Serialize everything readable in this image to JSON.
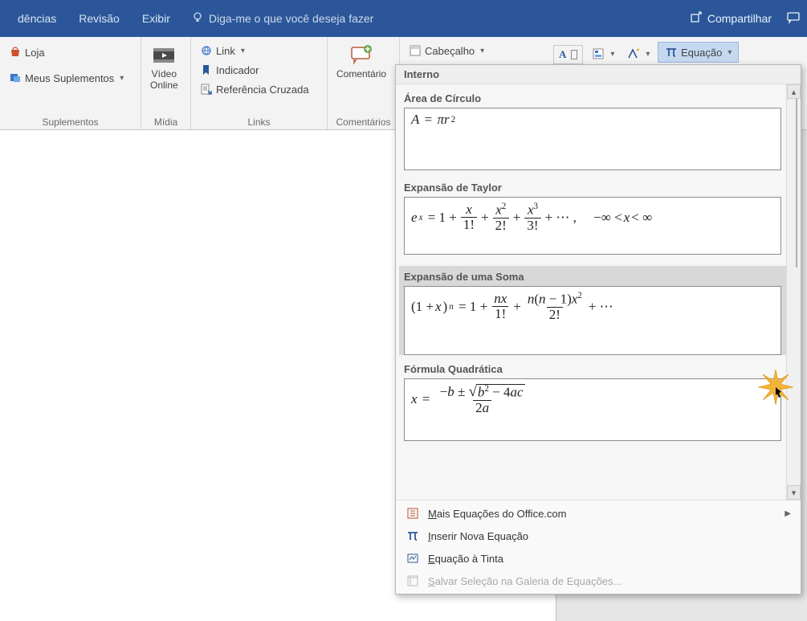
{
  "titlebar": {
    "tabs": [
      "dências",
      "Revisão",
      "Exibir"
    ],
    "tellme": "Diga-me o que você deseja fazer",
    "share": "Compartilhar"
  },
  "ribbon": {
    "suplementos": {
      "loja": "Loja",
      "meus": "Meus Suplementos",
      "label": "Suplementos"
    },
    "midia": {
      "video_l1": "Vídeo",
      "video_l2": "Online",
      "label": "Mídia"
    },
    "links": {
      "link": "Link",
      "indicador": "Indicador",
      "referencia": "Referência Cruzada",
      "label": "Links"
    },
    "comentarios": {
      "btn": "Comentário",
      "label": "Comentários"
    },
    "cabecalho": "Cabeçalho",
    "equacao": "Equação"
  },
  "gallery": {
    "header": "Interno",
    "items": [
      {
        "title": "Área de Círculo"
      },
      {
        "title": "Expansão de Taylor"
      },
      {
        "title": "Expansão de uma Soma"
      },
      {
        "title": "Fórmula Quadrática"
      }
    ],
    "footer": {
      "more": "Mais Equações do Office.com",
      "insert": "Inserir Nova Equação",
      "ink": "Equação à Tinta",
      "save": "Salvar Seleção na Galeria de Equações..."
    }
  },
  "chart_data": {
    "type": "table",
    "title": "Built-in equation gallery",
    "series": [
      {
        "name": "Área de Círculo",
        "formula": "A = π r^2"
      },
      {
        "name": "Expansão de Taylor",
        "formula": "e^x = 1 + x/1! + x^2/2! + x^3/3! + … ,  −∞ < x < ∞"
      },
      {
        "name": "Expansão de uma Soma",
        "formula": "(1 + x)^n = 1 + n x / 1! + n(n−1) x^2 / 2! + …"
      },
      {
        "name": "Fórmula Quadrática",
        "formula": "x = ( −b ± √(b^2 − 4ac) ) / (2a)"
      }
    ]
  }
}
